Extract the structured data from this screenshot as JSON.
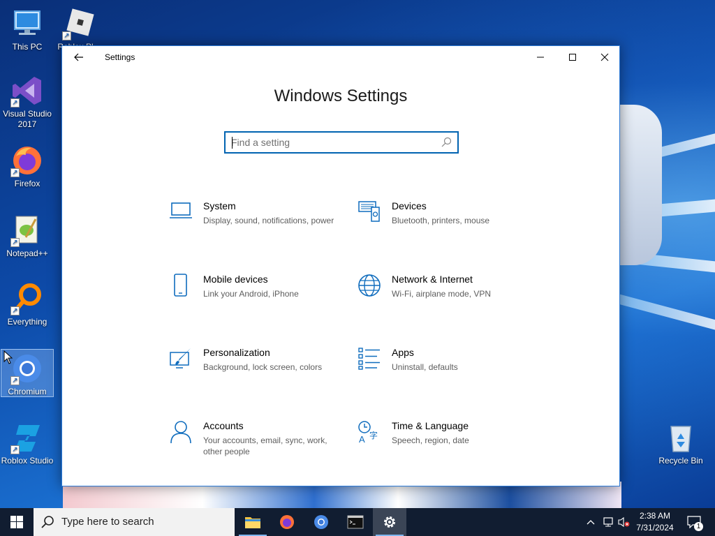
{
  "desktop": {
    "icons": [
      {
        "label": "This PC"
      },
      {
        "label": "Roblox Pl..."
      },
      {
        "label": "Visual Studio 2017"
      },
      {
        "label": "Firefox"
      },
      {
        "label": "Notepad++"
      },
      {
        "label": "Everything"
      },
      {
        "label": "Chromium"
      },
      {
        "label": "Roblox Studio"
      },
      {
        "label": "Recycle Bin"
      }
    ]
  },
  "window": {
    "title": "Settings",
    "heading": "Windows Settings",
    "search_placeholder": "Find a setting",
    "items": [
      {
        "name": "System",
        "desc": "Display, sound, notifications, power",
        "icon": "laptop-icon"
      },
      {
        "name": "Devices",
        "desc": "Bluetooth, printers, mouse",
        "icon": "devices-icon"
      },
      {
        "name": "Mobile devices",
        "desc": "Link your Android, iPhone",
        "icon": "phone-icon"
      },
      {
        "name": "Network & Internet",
        "desc": "Wi-Fi, airplane mode, VPN",
        "icon": "globe-icon"
      },
      {
        "name": "Personalization",
        "desc": "Background, lock screen, colors",
        "icon": "paint-icon"
      },
      {
        "name": "Apps",
        "desc": "Uninstall, defaults",
        "icon": "apps-list-icon"
      },
      {
        "name": "Accounts",
        "desc": "Your accounts, email, sync, work, other people",
        "icon": "person-icon"
      },
      {
        "name": "Time & Language",
        "desc": "Speech, region, date",
        "icon": "time-language-icon"
      }
    ]
  },
  "taskbar": {
    "search_text": "Type here to search",
    "time": "2:38 AM",
    "date": "7/31/2024",
    "notification_count": "1"
  },
  "colors": {
    "accent": "#0063b1",
    "icon_blue": "#0f6cbd"
  }
}
